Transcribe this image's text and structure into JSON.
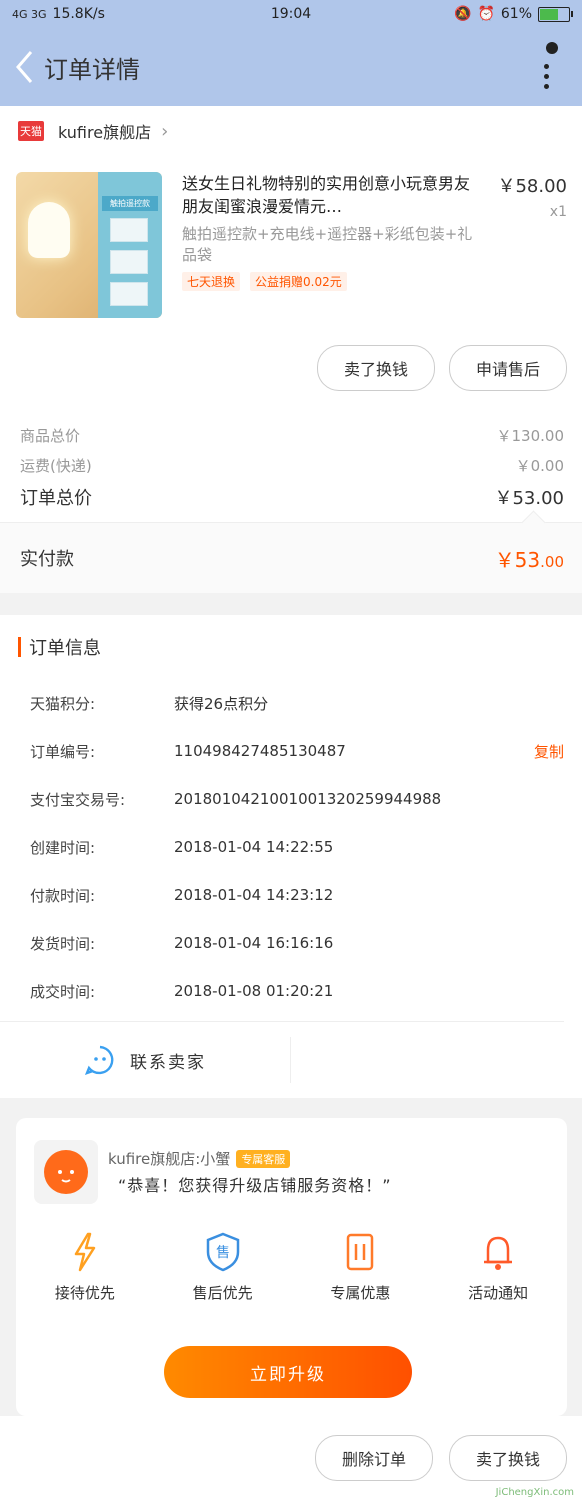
{
  "status_bar": {
    "signal": "4G 3G",
    "speed": "15.8K/s",
    "time": "19:04",
    "battery": "61%"
  },
  "nav": {
    "title": "订单详情"
  },
  "store": {
    "logo_text": "天猫",
    "name": "kufire旗舰店"
  },
  "product": {
    "title": "送女生日礼物特别的实用创意小玩意男友朋友闺蜜浪漫爱情元…",
    "spec": "触拍遥控款+充电线+遥控器+彩纸包装+礼品袋",
    "tags": [
      "七天退换",
      "公益捐赠0.02元"
    ],
    "price": "￥58.00",
    "quantity": "x1",
    "thumb_text": "触拍遥控款"
  },
  "actions": {
    "sell_exchange": "卖了换钱",
    "after_sale": "申请售后"
  },
  "summary": {
    "goods_label": "商品总价",
    "goods_value": "￥130.00",
    "shipping_label": "运费(快递)",
    "shipping_value": "￥0.00",
    "total_label": "订单总价",
    "total_value": "￥53.00"
  },
  "paid": {
    "label": "实付款",
    "value_main": "￥53",
    "value_decimal": ".00"
  },
  "order_info": {
    "title": "订单信息",
    "rows": [
      {
        "key": "天猫积分:",
        "value": "获得26点积分"
      },
      {
        "key": "订单编号:",
        "value": "110498427485130487",
        "action": "复制"
      },
      {
        "key": "支付宝交易号:",
        "value": "2018010421001001320259944988"
      },
      {
        "key": "创建时间:",
        "value": "2018-01-04 14:22:55"
      },
      {
        "key": "付款时间:",
        "value": "2018-01-04 14:23:12"
      },
      {
        "key": "发货时间:",
        "value": "2018-01-04 16:16:16"
      },
      {
        "key": "成交时间:",
        "value": "2018-01-08 01:20:21"
      }
    ]
  },
  "contact": {
    "label": "联系卖家"
  },
  "service_card": {
    "name": "kufire旗舰店:小蟹",
    "badge": "专属客服",
    "message": "“恭喜！您获得升级店铺服务资格！”",
    "perks": [
      {
        "label": "接待优先",
        "icon": "lightning-icon",
        "color": "#ffa020"
      },
      {
        "label": "售后优先",
        "icon": "shield-icon",
        "color": "#3a8fe0"
      },
      {
        "label": "专属优惠",
        "icon": "coupon-icon",
        "color": "#ff7a2a"
      },
      {
        "label": "活动通知",
        "icon": "bell-icon",
        "color": "#ff5a2a"
      }
    ],
    "upgrade_button": "立即升级"
  },
  "bottom_bar": {
    "delete_order": "删除订单",
    "sell_exchange": "卖了换钱"
  },
  "watermark": "JiChengXin.com"
}
